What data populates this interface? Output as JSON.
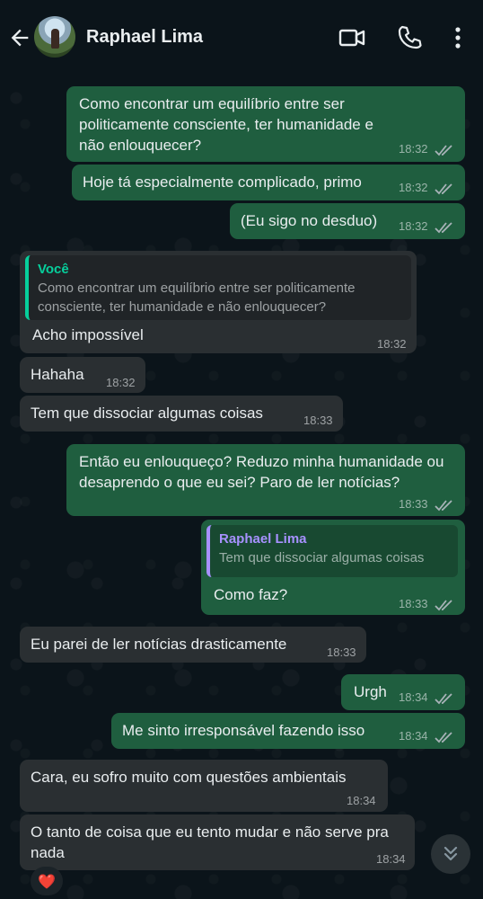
{
  "header": {
    "contact_name": "Raphael Lima"
  },
  "messages": [
    {
      "dir": "out",
      "text": "Como encontrar um equilíbrio entre ser politicamente consciente, ter humanidade e não enlouquecer?",
      "time": "18:32",
      "status": "read"
    },
    {
      "dir": "out",
      "text": "Hoje tá especialmente complicado, primo",
      "time": "18:32",
      "status": "read"
    },
    {
      "dir": "out",
      "text": "(Eu sigo no desduo)",
      "time": "18:32",
      "status": "read"
    },
    {
      "dir": "in",
      "quote": {
        "author": "Você",
        "text": "Como encontrar um equilíbrio entre ser politicamente consciente, ter humanidade e não enlouquecer?"
      },
      "text": "Acho impossível",
      "time": "18:32"
    },
    {
      "dir": "in",
      "text": "Hahaha",
      "time": "18:32"
    },
    {
      "dir": "in",
      "text": "Tem que dissociar algumas coisas",
      "time": "18:33"
    },
    {
      "dir": "out",
      "text": "Então eu enlouqueço? Reduzo minha humanidade ou desaprendo o que eu sei? Paro de ler notícias?",
      "time": "18:33",
      "status": "read"
    },
    {
      "dir": "out",
      "quote": {
        "author": "Raphael Lima",
        "text": "Tem que dissociar algumas coisas"
      },
      "text": "Como faz?",
      "time": "18:33",
      "status": "read"
    },
    {
      "dir": "in",
      "text": "Eu parei de ler notícias drasticamente",
      "time": "18:33"
    },
    {
      "dir": "out",
      "text": "Urgh",
      "time": "18:34",
      "status": "read"
    },
    {
      "dir": "out",
      "text": "Me sinto irresponsável fazendo isso",
      "time": "18:34",
      "status": "read"
    },
    {
      "dir": "in",
      "text": "Cara, eu sofro muito com questões ambientais",
      "time": "18:34"
    },
    {
      "dir": "in",
      "text": "O tanto de coisa que eu tento mudar e não serve pra nada",
      "time": "18:34",
      "reaction": "❤️"
    }
  ],
  "colors": {
    "background": "#0b141a",
    "outgoing_bubble": "#1f5e3f",
    "incoming_bubble": "#2a2f32",
    "read_ticks": "#a8b3b8",
    "quote_self": "#06cf9c",
    "quote_contact": "#a791ff"
  },
  "icons": [
    "back-arrow-icon",
    "video-call-icon",
    "voice-call-icon",
    "more-options-icon",
    "double-check-icon",
    "scroll-down-icon"
  ]
}
